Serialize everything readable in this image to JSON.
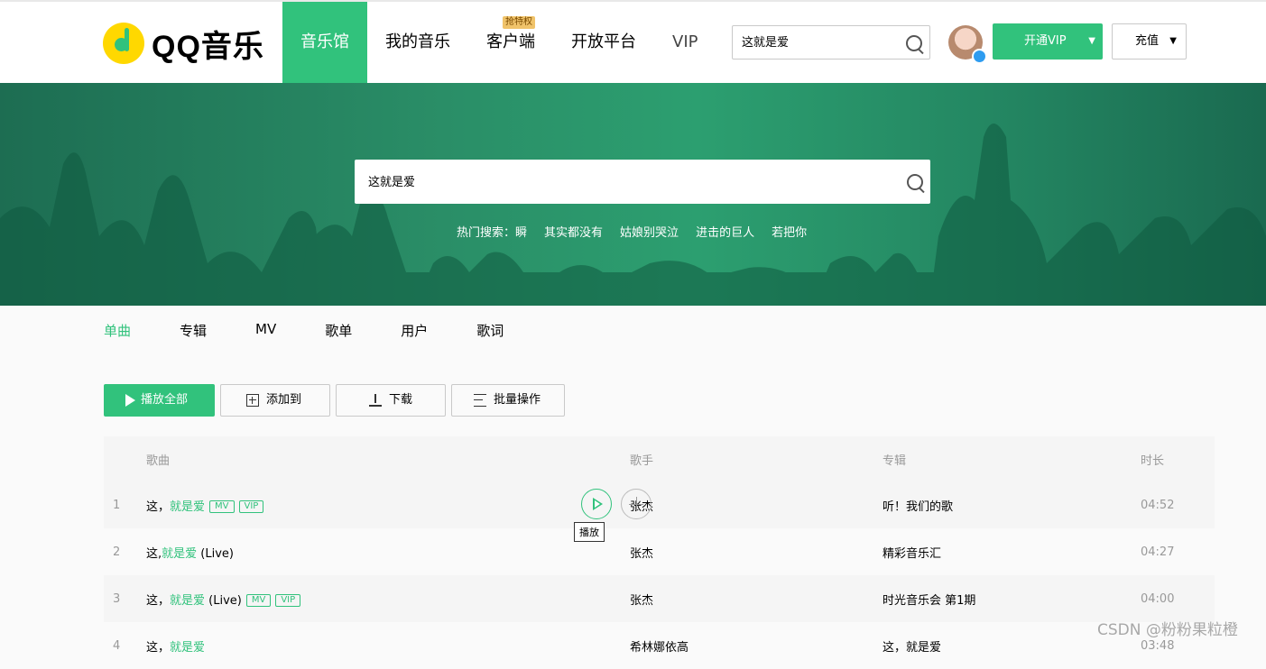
{
  "header": {
    "logo_text": "QQ音乐",
    "nav": [
      {
        "label": "音乐馆",
        "active": true
      },
      {
        "label": "我的音乐",
        "active": false
      },
      {
        "label": "客户端",
        "active": false,
        "badge": "抢特权"
      },
      {
        "label": "开放平台",
        "active": false
      },
      {
        "label": "VIP",
        "active": false
      }
    ],
    "search_value": "这就是爱",
    "vip_button": "开通VIP",
    "charge_button": "充值"
  },
  "banner": {
    "search_value": "这就是爱",
    "hot_label": "热门搜索：",
    "hot_items": [
      "瞬",
      "其实都没有",
      "姑娘别哭泣",
      "进击的巨人",
      "若把你"
    ]
  },
  "tabs": [
    "单曲",
    "专辑",
    "MV",
    "歌单",
    "用户",
    "歌词"
  ],
  "actions": {
    "play_all": "播放全部",
    "add_to": "添加到",
    "download": "下载",
    "batch": "批量操作"
  },
  "table": {
    "headers": {
      "song": "歌曲",
      "singer": "歌手",
      "album": "专辑",
      "duration": "时长"
    },
    "rows": [
      {
        "num": "1",
        "prefix": "这，",
        "highlight": "就是爱",
        "suffix": "",
        "tags": [
          "MV",
          "VIP"
        ],
        "singer": "张杰",
        "album": "听！我们的歌",
        "duration": "04:52"
      },
      {
        "num": "2",
        "prefix": "这,",
        "highlight": "就是爱",
        "suffix": " (Live)",
        "tags": [],
        "singer": "张杰",
        "album": "精彩音乐汇",
        "duration": "04:27"
      },
      {
        "num": "3",
        "prefix": "这，",
        "highlight": "就是爱",
        "suffix": " (Live)",
        "tags": [
          "MV",
          "VIP"
        ],
        "singer": "张杰",
        "album": "时光音乐会 第1期",
        "duration": "04:00"
      },
      {
        "num": "4",
        "prefix": "这，",
        "highlight": "就是爱",
        "suffix": "",
        "tags": [],
        "singer": "希林娜依高",
        "album": "这，就是爱",
        "duration": "03:48"
      }
    ]
  },
  "tooltip": "播放",
  "watermark": "CSDN @粉粉果粒橙",
  "colors": {
    "accent": "#31c27c",
    "banner": "#2a8e67"
  }
}
